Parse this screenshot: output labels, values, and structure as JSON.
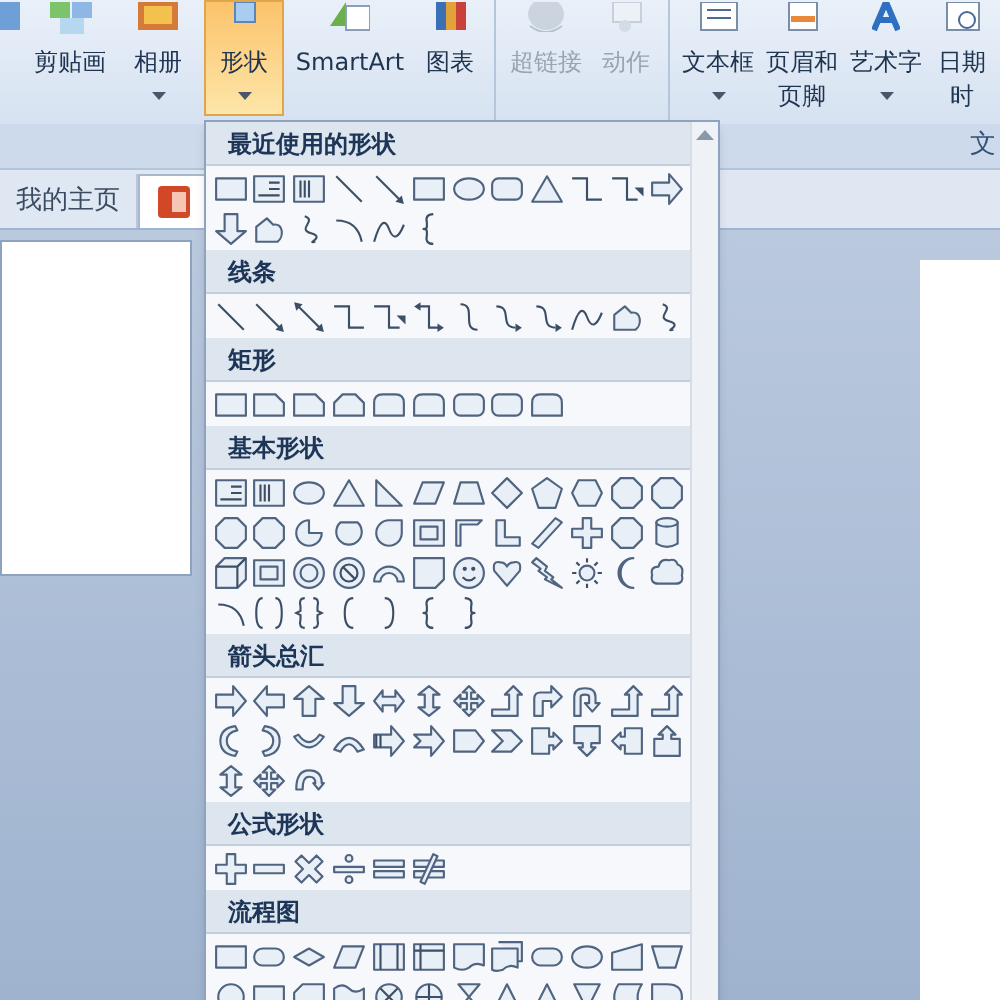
{
  "ribbon": {
    "groups": [
      {
        "buttons": [
          {
            "has_menu": false,
            "selected": false,
            "disabled": false
          },
          {
            "label": [
              "剪贴画"
            ],
            "has_menu": false,
            "selected": false,
            "disabled": false
          },
          {
            "label": [
              "相册"
            ],
            "has_menu": true,
            "selected": false,
            "disabled": false
          },
          {
            "label": [
              "形状"
            ],
            "has_menu": true,
            "selected": true,
            "disabled": false
          },
          {
            "label": [
              "SmartArt"
            ],
            "has_menu": false,
            "selected": false,
            "disabled": false
          },
          {
            "label": [
              "图表"
            ],
            "has_menu": false,
            "selected": false,
            "disabled": false
          }
        ]
      },
      {
        "buttons": [
          {
            "label": [
              "超链接"
            ],
            "has_menu": false,
            "selected": false,
            "disabled": true
          },
          {
            "label": [
              "动作"
            ],
            "has_menu": false,
            "selected": false,
            "disabled": true
          }
        ]
      },
      {
        "label": "文",
        "buttons": [
          {
            "label": [
              "文本框"
            ],
            "has_menu": true,
            "selected": false,
            "disabled": false
          },
          {
            "label": [
              "页眉和",
              "页脚"
            ],
            "has_menu": false,
            "selected": false,
            "disabled": false
          },
          {
            "label": [
              "艺术字"
            ],
            "has_menu": true,
            "selected": false,
            "disabled": false
          },
          {
            "label": [
              "日期",
              "时"
            ],
            "has_menu": false,
            "selected": false,
            "disabled": false
          }
        ]
      }
    ]
  },
  "doc_tabs": [
    {
      "label": "我的主页",
      "selected": false
    },
    {
      "selected": true
    }
  ],
  "shapes_menu": {
    "sections": [
      {
        "title": "最近使用的形状"
      },
      {
        "title": "线条"
      },
      {
        "title": "矩形"
      },
      {
        "title": "基本形状"
      },
      {
        "title": "箭头总汇"
      },
      {
        "title": "公式形状"
      },
      {
        "title": "流程图"
      }
    ]
  }
}
